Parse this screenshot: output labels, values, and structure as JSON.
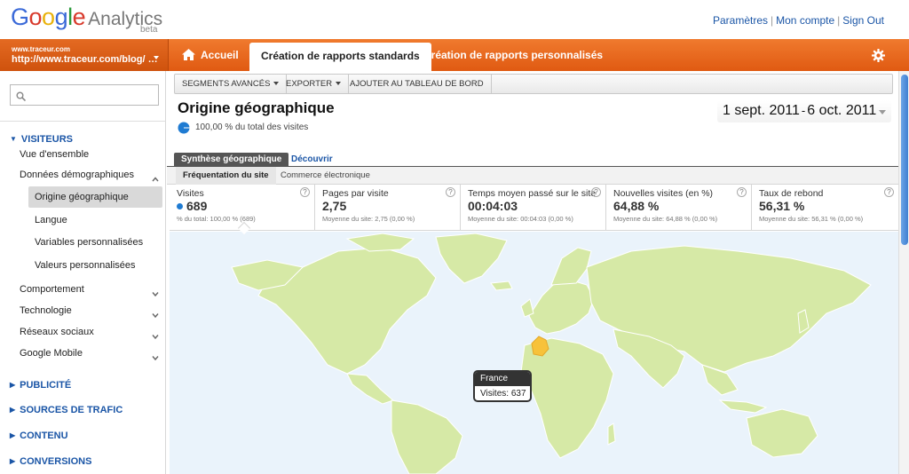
{
  "header": {
    "logo": {
      "g1": "G",
      "g2": "o",
      "g3": "o",
      "g4": "g",
      "g5": "l",
      "g6": "e",
      "product": "Analytics",
      "badge": "beta"
    },
    "links": {
      "settings": "Paramètres",
      "account": "Mon compte",
      "signout": "Sign Out",
      "separator": "|"
    }
  },
  "navbar": {
    "profile": {
      "small": "www.traceur.com",
      "url": "http://www.traceur.com/blog/ …"
    },
    "tabs": {
      "home": "Accueil",
      "standard": "Création de rapports standards",
      "custom": "Création de rapports personnalisés"
    }
  },
  "sidebar": {
    "search_placeholder": "",
    "visitors_section": "VISITEURS",
    "items": {
      "overview": "Vue d'ensemble",
      "demographics": "Données démographiques",
      "geo": "Origine géographique",
      "language": "Langue",
      "custom_vars": "Variables personnalisées",
      "custom_vals": "Valeurs personnalisées",
      "behavior": "Comportement",
      "technology": "Technologie",
      "social": "Réseaux sociaux",
      "mobile": "Google Mobile"
    },
    "sections": {
      "ads": "PUBLICITÉ",
      "traffic": "SOURCES DE TRAFIC",
      "content": "CONTENU",
      "conversions": "CONVERSIONS"
    }
  },
  "toolbar": {
    "segments": "SEGMENTS AVANCÉS",
    "export": "EXPORTER",
    "dashboard": "AJOUTER AU TABLEAU DE BORD"
  },
  "report": {
    "title": "Origine géographique",
    "pct_of_total": "100,00 % du total des visites",
    "date_start": "1 sept. 2011",
    "date_sep": "-",
    "date_end": "6 oct. 2011"
  },
  "subtabs": {
    "geo": "Synthèse géographique",
    "discover": "Découvrir"
  },
  "viewtabs": {
    "freq": "Fréquentation du site",
    "commerce": "Commerce électronique"
  },
  "scorecards": [
    {
      "label": "Visites",
      "value": "689",
      "sub": "% du total: 100,00 % (689)"
    },
    {
      "label": "Pages par visite",
      "value": "2,75",
      "sub": "Moyenne du site: 2,75 (0,00 %)"
    },
    {
      "label": "Temps moyen passé sur le site",
      "value": "00:04:03",
      "sub": "Moyenne du site: 00:04:03 (0,00 %)"
    },
    {
      "label": "Nouvelles visites (en %)",
      "value": "64,88 %",
      "sub": "Moyenne du site: 64,88 % (0,00 %)"
    },
    {
      "label": "Taux de rebond",
      "value": "56,31 %",
      "sub": "Moyenne du site: 56,31 % (0,00 %)"
    }
  ],
  "help_glyph": "?",
  "map": {
    "tooltip_country": "France",
    "tooltip_visits": "Visites: 637",
    "colors": {
      "ocean": "#eaf3fb",
      "land": "#d6e9a6",
      "highlight": "#f7c23a",
      "border": "#ffffff"
    }
  },
  "colors": {
    "nav_orange": "#e8641c",
    "link_blue": "#1a55a6",
    "metric_dot": "#1f7bd2"
  }
}
